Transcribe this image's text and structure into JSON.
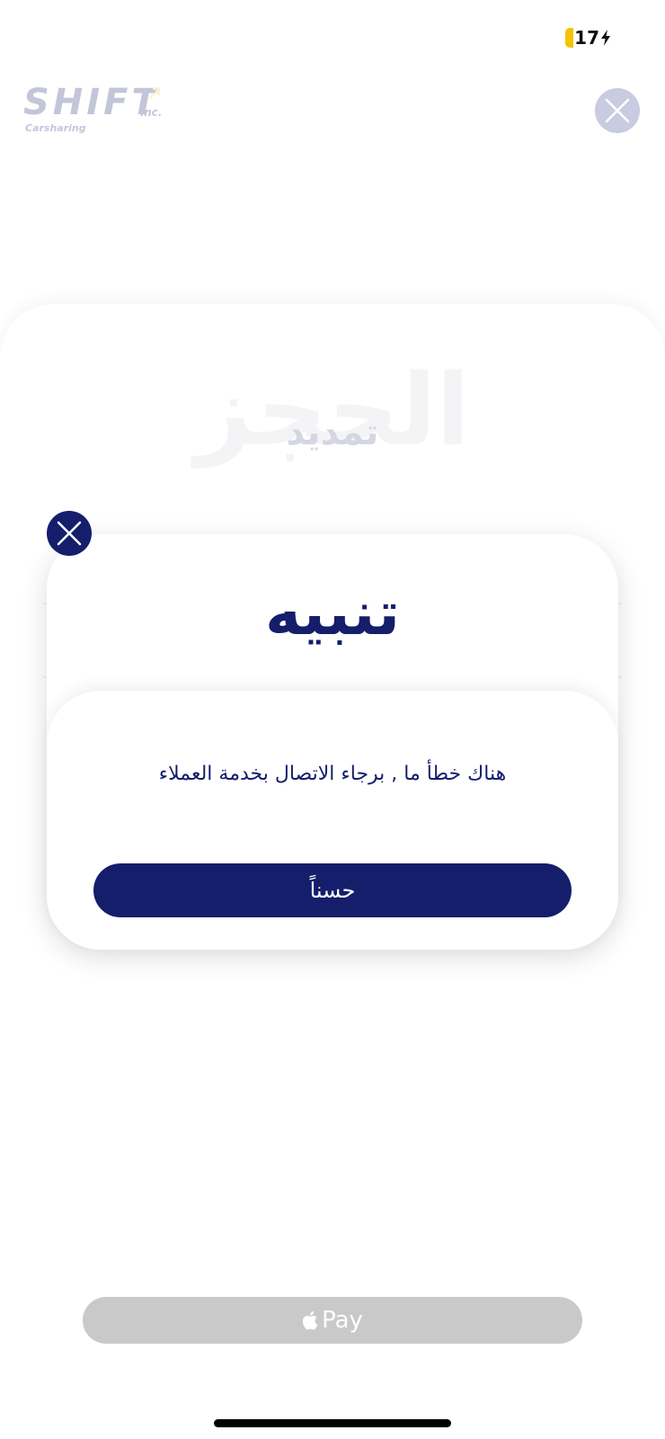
{
  "status_bar": {
    "battery_level": "17",
    "charging": true
  },
  "logo": {
    "name": "SHIFT",
    "suffix": "inc.",
    "tagline": "Carsharing"
  },
  "background": {
    "watermark": "الحجز",
    "title": "تمديد"
  },
  "alert": {
    "title": "تنبيه",
    "message": "هناك خطأ ما , برجاء الاتصال بخدمة العملاء",
    "ok_label": "حسناً"
  },
  "payment": {
    "apple_pay_label": "Pay"
  },
  "colors": {
    "primary": "#141e6b",
    "battery": "#f2c500",
    "apple_pay_disabled": "#c9c9c9",
    "close_bg_faded": "#c9cbe0"
  },
  "icons": {
    "modal_close": "close-icon",
    "top_close": "close-icon",
    "apple": "apple-icon",
    "bolt": "bolt-icon"
  }
}
